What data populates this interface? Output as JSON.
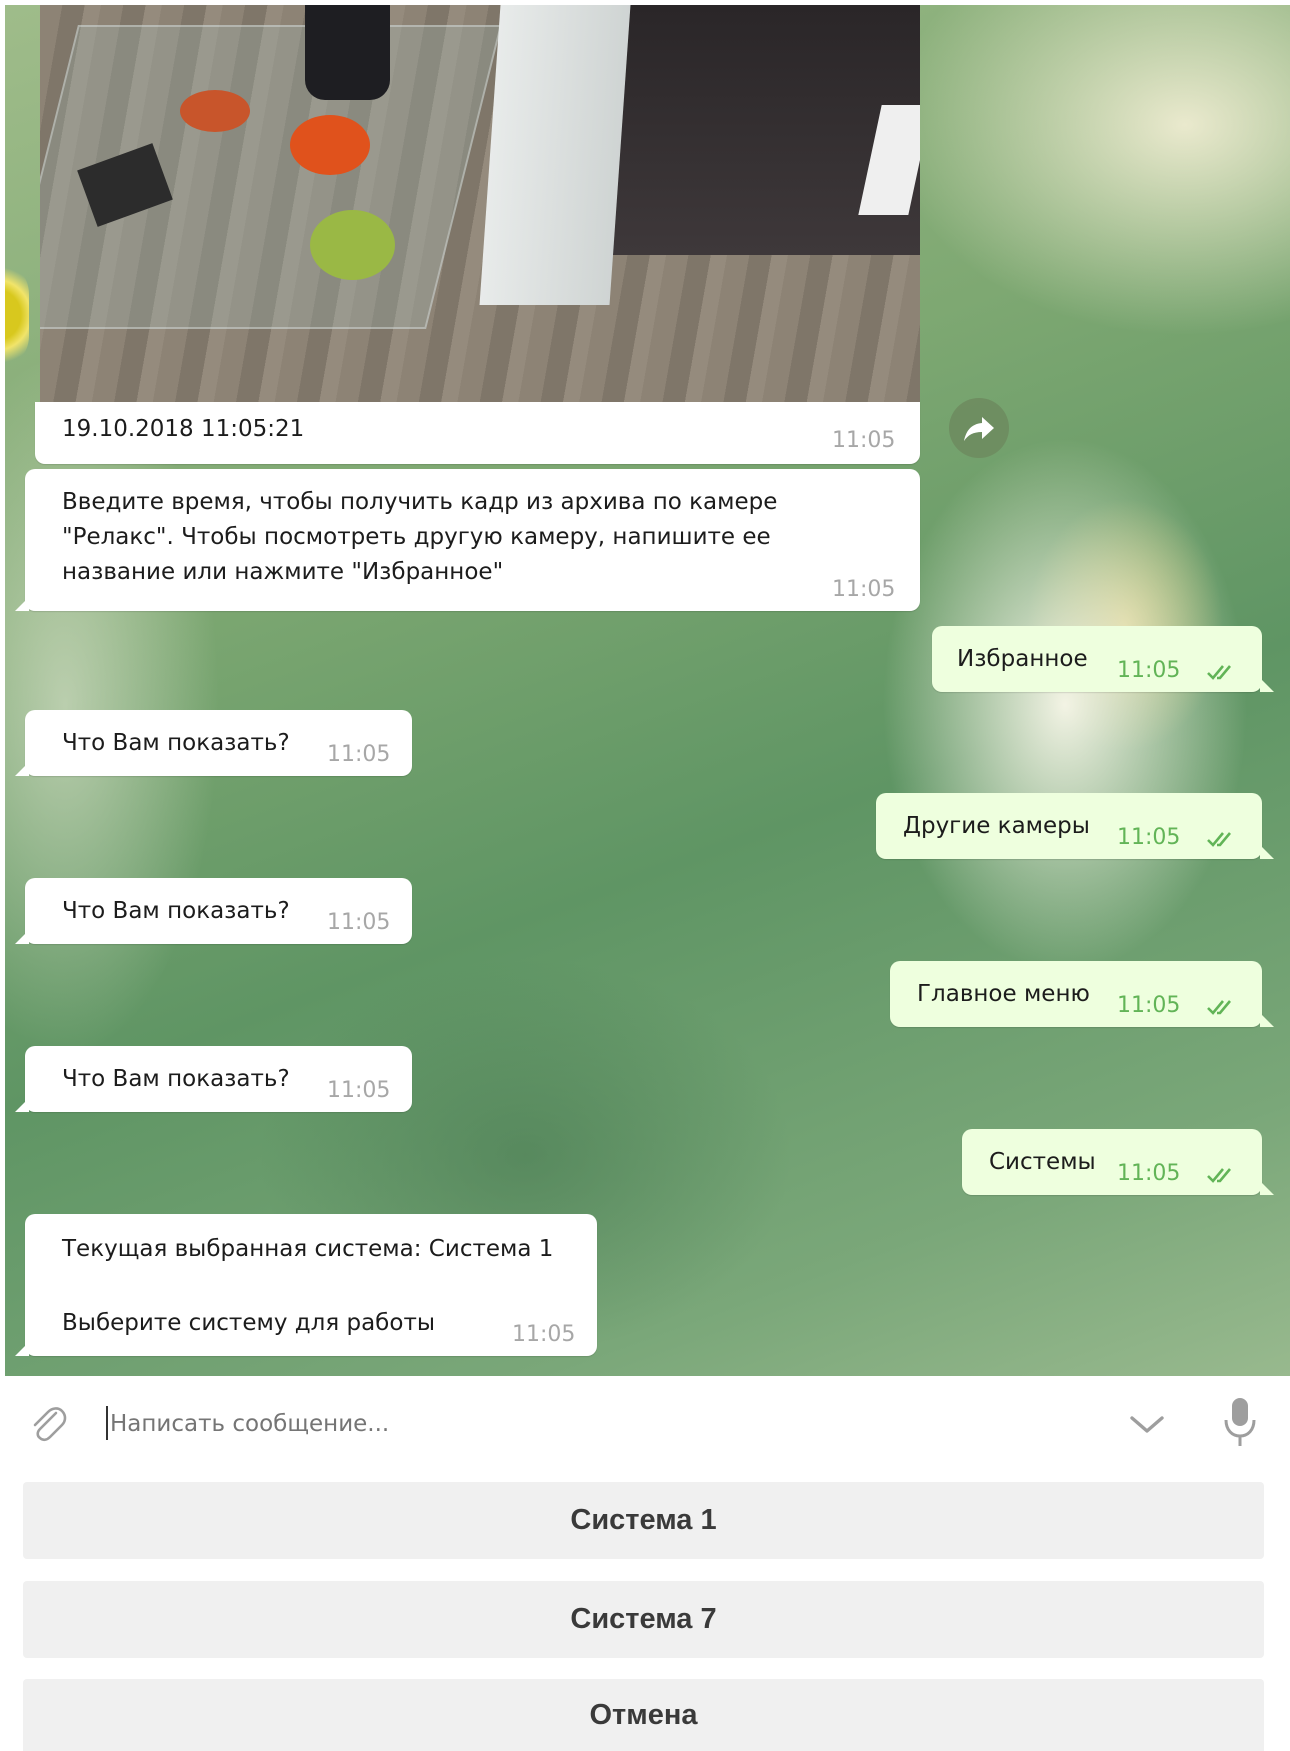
{
  "colors": {
    "incoming_bubble": "#ffffff",
    "outgoing_bubble": "#eeffde",
    "time_incoming": "#a7a7a7",
    "time_outgoing": "#62b457",
    "keyboard_button": "#f0f0f0"
  },
  "messages": {
    "photo_caption": "19.10.2018 11:05:21",
    "photo_time": "11:05",
    "prompt_text": [
      "Введите время, чтобы получить кадр из архива по камере",
      "\"Релакс\". Чтобы посмотреть другую камеру, напишите ее",
      "название или нажмите \"Избранное\""
    ],
    "prompt_time": "11:05",
    "out1": {
      "text": "Избранное",
      "time": "11:05"
    },
    "in1": {
      "text": "Что Вам показать?",
      "time": "11:05"
    },
    "out2": {
      "text": "Другие камеры",
      "time": "11:05"
    },
    "in2": {
      "text": "Что Вам показать?",
      "time": "11:05"
    },
    "out3": {
      "text": "Главное меню",
      "time": "11:05"
    },
    "in3": {
      "text": "Что Вам показать?",
      "time": "11:05"
    },
    "out4": {
      "text": "Системы",
      "time": "11:05"
    },
    "last": {
      "line1": "Текущая выбранная система: Система 1",
      "line2": "Выберите систему для работы",
      "time": "11:05"
    }
  },
  "composer": {
    "placeholder": "Написать сообщение..."
  },
  "keyboard": {
    "buttons": [
      "Система 1",
      "Система 7",
      "Отмена"
    ]
  },
  "icons": [
    "share-icon",
    "read-receipt-icon",
    "attach-icon",
    "chevron-down-icon",
    "microphone-icon"
  ]
}
